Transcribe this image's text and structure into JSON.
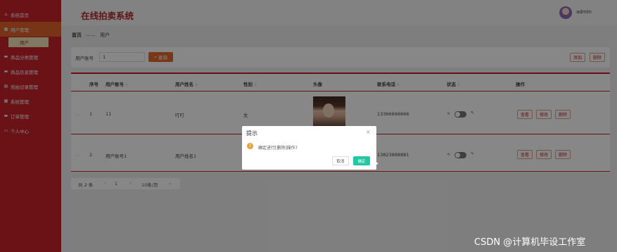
{
  "sidebar": {
    "items": [
      {
        "icon": "home-icon",
        "label": "系统首页"
      },
      {
        "icon": "grid-icon",
        "label": "用户管理"
      },
      {
        "icon": "chat-icon",
        "label": "商品分类管理"
      },
      {
        "icon": "chat-icon",
        "label": "商品信息管理"
      },
      {
        "icon": "doc-icon",
        "label": "竞拍记录管理"
      },
      {
        "icon": "grid-icon",
        "label": "系统管理"
      },
      {
        "icon": "chat-icon",
        "label": "订单管理"
      },
      {
        "icon": "user-icon",
        "label": "个人中心"
      }
    ],
    "submenu": {
      "label": "用户"
    }
  },
  "header": {
    "title": "在线拍卖系统",
    "username": "admin"
  },
  "breadcrumb": {
    "home": "首页",
    "separator": "——",
    "current": "用户"
  },
  "search": {
    "label": "用户账号",
    "value": "1",
    "query_label": "查询",
    "add_label": "添加",
    "delete_label": "删除"
  },
  "table": {
    "headers": [
      "序号",
      "用户账号",
      "用户姓名",
      "性别",
      "头像",
      "联系电话",
      "状态",
      "操作"
    ],
    "rows": [
      {
        "index": "1",
        "account": "11",
        "name": "叮叮",
        "gender": "女",
        "phone": "13366666666"
      },
      {
        "index": "2",
        "account": "用户账号1",
        "name": "用户姓名1",
        "gender": "",
        "phone": "13823888881"
      }
    ],
    "actions": {
      "view": "查看",
      "edit": "修改",
      "delete": "删除"
    }
  },
  "pagination": {
    "total": "共 2 条",
    "prev": "‹",
    "page": "1",
    "next": "›",
    "size": "10条/页",
    "caret": "⌄"
  },
  "dialog": {
    "title": "提示",
    "close": "×",
    "message": "确定进行[删除]操作?",
    "cancel": "取消",
    "confirm": "确定"
  },
  "watermark": "CSDN @计算机毕设工作室",
  "colors": {
    "sidebar": "#c8222a",
    "accent": "#e36b2c",
    "confirm": "#22c7a3",
    "warning": "#e6a23c"
  }
}
